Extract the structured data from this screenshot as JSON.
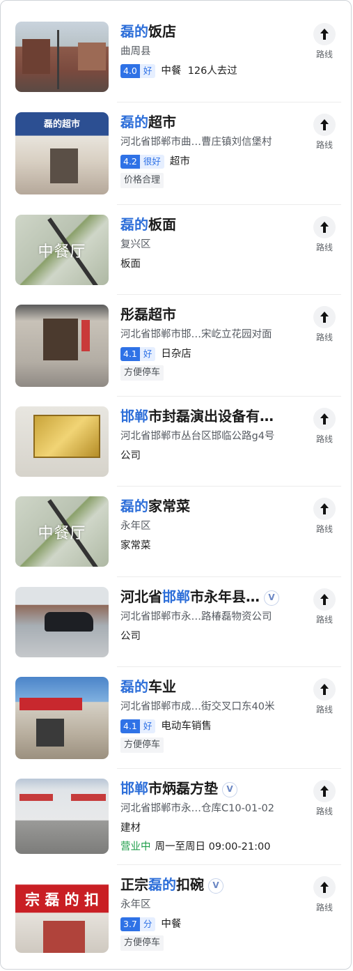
{
  "route_label": "路线",
  "places": [
    {
      "title_parts": [
        {
          "t": "磊的",
          "hl": true
        },
        {
          "t": "饭店",
          "hl": false
        }
      ],
      "verified": false,
      "subtitle": "曲周县",
      "rating": "4.0",
      "rating_word": "好",
      "category": "中餐",
      "extra": "126人去过",
      "tag": "",
      "thumb_label": "",
      "hours_status": "",
      "hours": ""
    },
    {
      "title_parts": [
        {
          "t": "磊的",
          "hl": true
        },
        {
          "t": "超市",
          "hl": false
        }
      ],
      "verified": false,
      "subtitle": "河北省邯郸市曲…曹庄镇刘信堡村",
      "rating": "4.2",
      "rating_word": "很好",
      "category": "超市",
      "extra": "",
      "tag": "价格合理",
      "thumb_label": "",
      "hours_status": "",
      "hours": ""
    },
    {
      "title_parts": [
        {
          "t": "磊的",
          "hl": true
        },
        {
          "t": "板面",
          "hl": false
        }
      ],
      "verified": false,
      "subtitle": "复兴区",
      "rating": "",
      "rating_word": "",
      "category": "板面",
      "extra": "",
      "tag": "",
      "thumb_label": "中餐厅",
      "hours_status": "",
      "hours": ""
    },
    {
      "title_parts": [
        {
          "t": "彤磊超市",
          "hl": false
        }
      ],
      "verified": false,
      "subtitle": "河北省邯郸市邯…宋屹立花园对面",
      "rating": "4.1",
      "rating_word": "好",
      "category": "日杂店",
      "extra": "",
      "tag": "方便停车",
      "thumb_label": "",
      "hours_status": "",
      "hours": ""
    },
    {
      "title_parts": [
        {
          "t": "邯郸",
          "hl": true
        },
        {
          "t": "市封磊演出设备有…",
          "hl": false
        }
      ],
      "verified": false,
      "subtitle": "河北省邯郸市丛台区邯临公路g4号",
      "rating": "",
      "rating_word": "",
      "category": "公司",
      "extra": "",
      "tag": "",
      "thumb_label": "",
      "hours_status": "",
      "hours": ""
    },
    {
      "title_parts": [
        {
          "t": "磊的",
          "hl": true
        },
        {
          "t": "家常菜",
          "hl": false
        }
      ],
      "verified": false,
      "subtitle": "永年区",
      "rating": "",
      "rating_word": "",
      "category": "家常菜",
      "extra": "",
      "tag": "",
      "thumb_label": "中餐厅",
      "hours_status": "",
      "hours": ""
    },
    {
      "title_parts": [
        {
          "t": "河北省",
          "hl": false
        },
        {
          "t": "邯郸",
          "hl": true
        },
        {
          "t": "市永年县…",
          "hl": false
        }
      ],
      "verified": true,
      "subtitle": "河北省邯郸市永…路椿磊物资公司",
      "rating": "",
      "rating_word": "",
      "category": "公司",
      "extra": "",
      "tag": "",
      "thumb_label": "",
      "hours_status": "",
      "hours": ""
    },
    {
      "title_parts": [
        {
          "t": "磊的",
          "hl": true
        },
        {
          "t": "车业",
          "hl": false
        }
      ],
      "verified": false,
      "subtitle": "河北省邯郸市成…街交叉口东40米",
      "rating": "4.1",
      "rating_word": "好",
      "category": "电动车销售",
      "extra": "",
      "tag": "方便停车",
      "thumb_label": "",
      "hours_status": "",
      "hours": ""
    },
    {
      "title_parts": [
        {
          "t": "邯郸",
          "hl": true
        },
        {
          "t": "市炳磊方垫",
          "hl": false
        }
      ],
      "verified": true,
      "subtitle": "河北省邯郸市永…仓库C10-01-02",
      "rating": "",
      "rating_word": "",
      "category": "建材",
      "extra": "",
      "tag": "",
      "thumb_label": "",
      "hours_status": "营业中",
      "hours": "周一至周日 09:00-21:00"
    },
    {
      "title_parts": [
        {
          "t": "正宗",
          "hl": false
        },
        {
          "t": "磊的",
          "hl": true
        },
        {
          "t": "扣碗",
          "hl": false
        }
      ],
      "verified": true,
      "subtitle": "永年区",
      "rating": "3.7",
      "rating_word": "分",
      "category": "中餐",
      "extra": "",
      "tag": "方便停车",
      "thumb_label": "",
      "hours_status": "",
      "hours": ""
    }
  ],
  "thumb_signs": [
    "磊的超市",
    "宗 磊 的 扣"
  ],
  "colors": {
    "highlight": "#2e6fd9",
    "badge": "#2f72e6",
    "open": "#1e9e4a"
  }
}
